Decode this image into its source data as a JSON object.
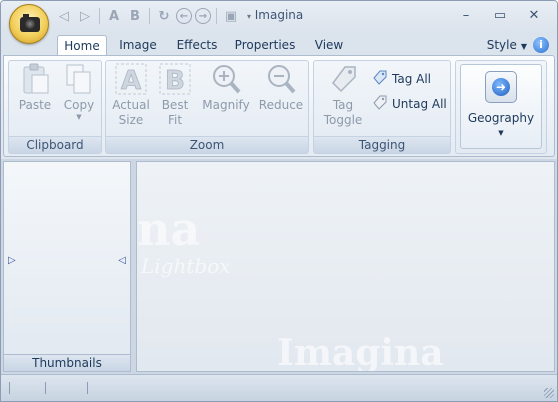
{
  "window": {
    "title": "Imagina"
  },
  "qat": {
    "dropdown_glyph": "▾"
  },
  "tabs": [
    "Home",
    "Image",
    "Effects",
    "Properties",
    "View"
  ],
  "style_menu": {
    "label": "Style"
  },
  "ribbon": {
    "clipboard": {
      "label": "Clipboard",
      "paste": "Paste",
      "copy": "Copy"
    },
    "zoom": {
      "label": "Zoom",
      "actual_size": [
        "Actual",
        "Size"
      ],
      "best_fit": [
        "Best",
        "Fit"
      ],
      "magnify": "Magnify",
      "reduce": "Reduce"
    },
    "tagging": {
      "label": "Tagging",
      "tag_toggle": [
        "Tag",
        "Toggle"
      ],
      "tag_all": "Tag All",
      "untag_all": "Untag All"
    },
    "geography": {
      "label": "Geography"
    }
  },
  "panels": {
    "thumbnails": "Thumbnails"
  },
  "watermark": {
    "big": "na",
    "small": "Lightbox",
    "bottom": "Imagina"
  },
  "colors": {
    "accent": "#1e395b",
    "ribbon_border": "#aebcd0",
    "orb": "#f2cf5a"
  }
}
